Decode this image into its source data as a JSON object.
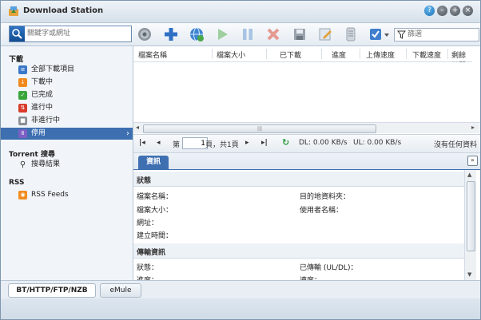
{
  "window": {
    "title": "Download Station"
  },
  "toolbar": {
    "search_placeholder": "關鍵字或網址",
    "filter_placeholder": "篩選"
  },
  "sidebar": {
    "downloads_title": "下載",
    "items": [
      {
        "label": "全部下載項目",
        "icon": "list-icon",
        "color": "#3a78c9"
      },
      {
        "label": "下載中",
        "icon": "download-arrow-icon",
        "color": "#f08a1c"
      },
      {
        "label": "已完成",
        "icon": "check-icon",
        "color": "#3aa53a"
      },
      {
        "label": "進行中",
        "icon": "active-icon",
        "color": "#d93b2b"
      },
      {
        "label": "非進行中",
        "icon": "inactive-icon",
        "color": "#8a8f96"
      },
      {
        "label": "停用",
        "icon": "pause-icon",
        "color": "#7b5fc4"
      }
    ],
    "torrent_title": "Torrent 搜尋",
    "search_results": "搜尋結果",
    "rss_title": "RSS",
    "rss_feeds": "RSS Feeds"
  },
  "grid": {
    "columns": [
      "檔案名稱",
      "檔案大小",
      "已下載",
      "進度",
      "上傳速度",
      "下載速度",
      "剩餘時間"
    ]
  },
  "pager": {
    "page_prefix": "第",
    "page_value": "1",
    "page_suffix": "頁，共1頁",
    "dl": "DL: 0.00 KB/s",
    "ul": "UL: 0.00 KB/s",
    "no_data": "沒有任何資料"
  },
  "details": {
    "tab": "資訊",
    "status_section": "狀態",
    "fields_left": [
      "檔案名稱：",
      "檔案大小：",
      "網址：",
      "建立時間："
    ],
    "fields_right": [
      "目的地資料夾：",
      "使用者名稱："
    ],
    "transfer_section": "傳輸資訊",
    "transfer_left": [
      "狀態：",
      "進度："
    ],
    "transfer_right": [
      "已傳輸 (UL/DL)：",
      "速度："
    ]
  },
  "bottom_tabs": [
    "BT/HTTP/FTP/NZB",
    "eMule"
  ]
}
